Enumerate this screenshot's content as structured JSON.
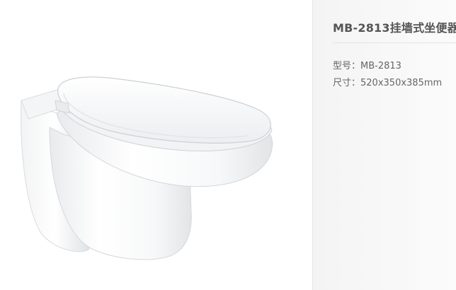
{
  "product": {
    "title": "MB-2813挂墙式坐便器",
    "image_subject": "wall-hung-toilet",
    "specs": [
      {
        "label": "型号：",
        "value": "MB-2813"
      },
      {
        "label": "尺寸：",
        "value": "520x350x385mm"
      }
    ]
  },
  "colors": {
    "info_background": "#f6f6f6",
    "title_text": "#555555",
    "spec_text": "#666666"
  }
}
